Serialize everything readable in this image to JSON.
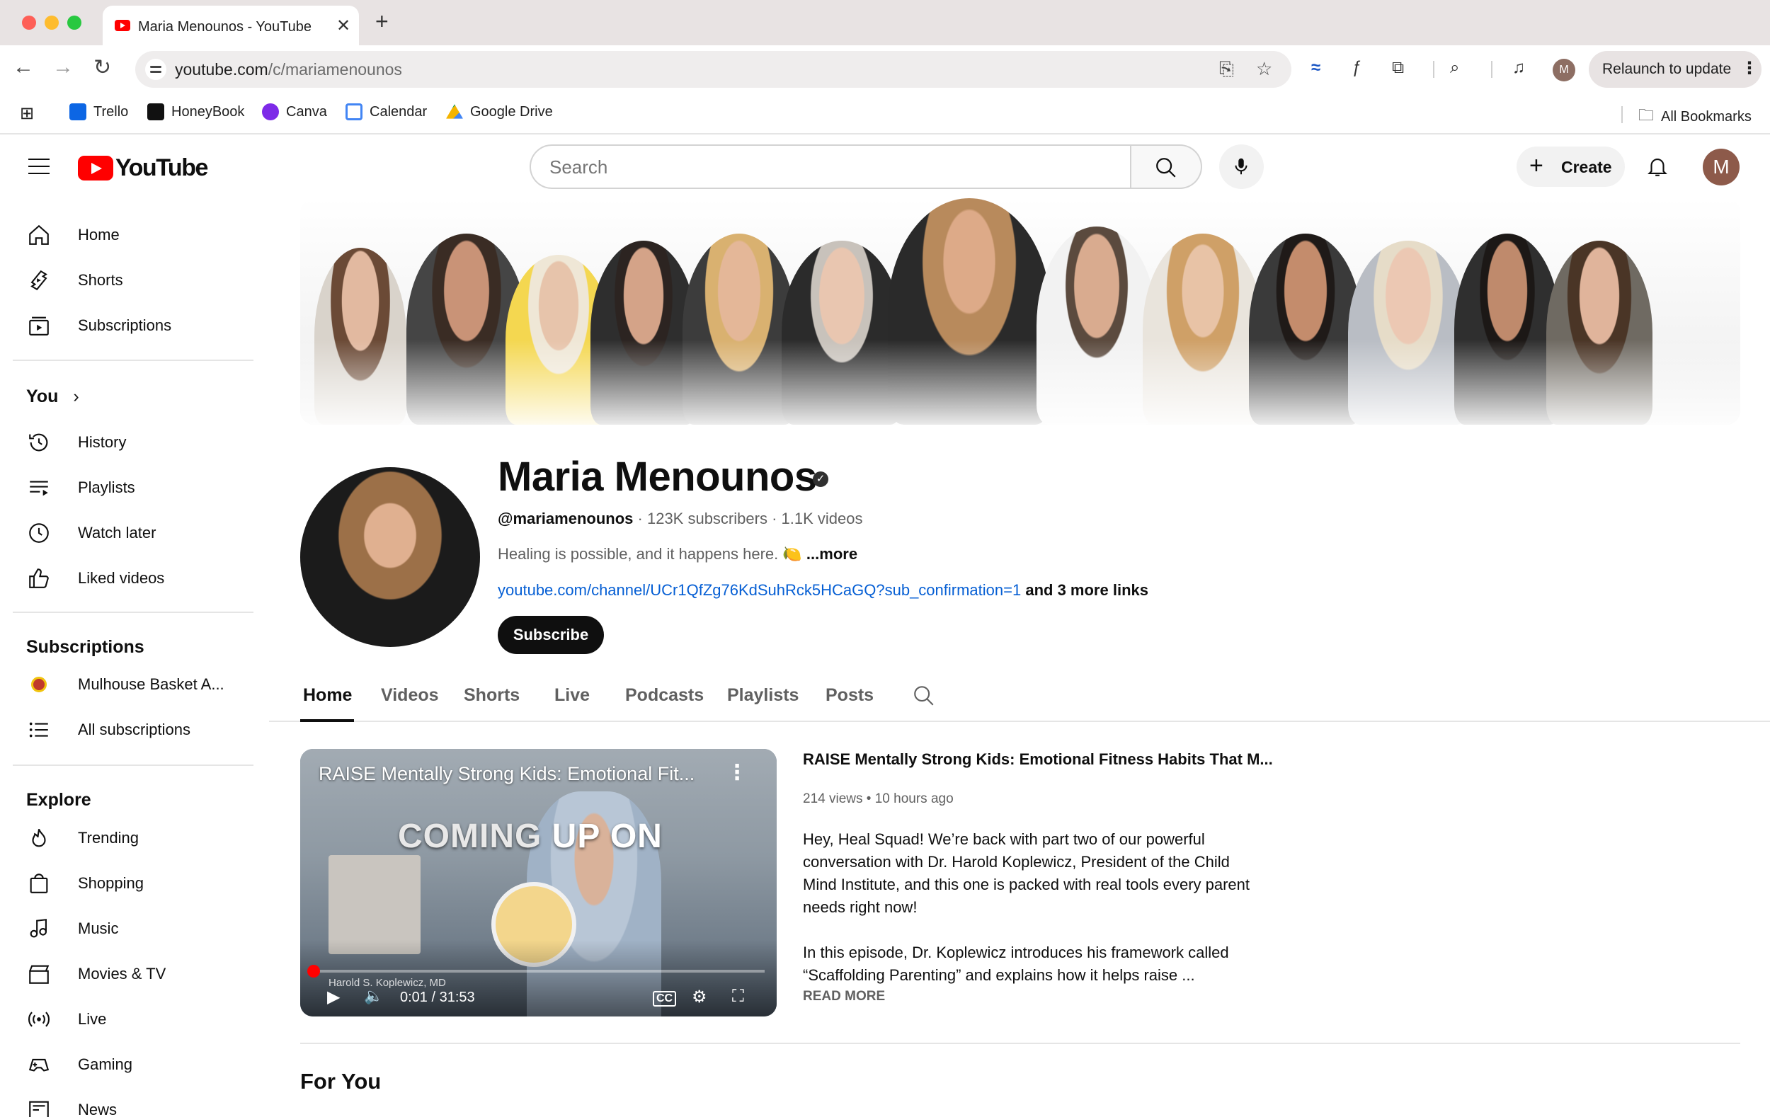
{
  "browser": {
    "tab_title": "Maria Menounos - YouTube",
    "url_host": "youtube.com",
    "url_path": "/c/mariamenounos",
    "profile_initial": "M",
    "relaunch_label": "Relaunch to update",
    "bookmarks": [
      "Trello",
      "HoneyBook",
      "Canva",
      "Calendar",
      "Google Drive"
    ],
    "all_bookmarks": "All Bookmarks"
  },
  "header": {
    "logo_text": "YouTube",
    "search_placeholder": "Search",
    "create_label": "Create",
    "avatar_initial": "M"
  },
  "sidebar": {
    "main": [
      {
        "label": "Home",
        "icon": "home-icon"
      },
      {
        "label": "Shorts",
        "icon": "shorts-icon"
      },
      {
        "label": "Subscriptions",
        "icon": "subscriptions-icon"
      }
    ],
    "you_heading": "You",
    "you_items": [
      {
        "label": "History",
        "icon": "history-icon"
      },
      {
        "label": "Playlists",
        "icon": "playlists-icon"
      },
      {
        "label": "Watch later",
        "icon": "watch-later-icon"
      },
      {
        "label": "Liked videos",
        "icon": "thumbs-up-icon"
      }
    ],
    "subs_heading": "Subscriptions",
    "subs_items": [
      {
        "label": "Mulhouse Basket A...",
        "icon": "channel-avatar"
      },
      {
        "label": "All subscriptions",
        "icon": "list-icon"
      }
    ],
    "explore_heading": "Explore",
    "explore_items": [
      {
        "label": "Trending",
        "icon": "trending-icon"
      },
      {
        "label": "Shopping",
        "icon": "shopping-bag-icon"
      },
      {
        "label": "Music",
        "icon": "music-note-icon"
      },
      {
        "label": "Movies & TV",
        "icon": "clapperboard-icon"
      },
      {
        "label": "Live",
        "icon": "live-icon"
      },
      {
        "label": "Gaming",
        "icon": "gamepad-icon"
      },
      {
        "label": "News",
        "icon": "newspaper-icon"
      }
    ]
  },
  "channel": {
    "name": "Maria Menounos",
    "handle": "@mariamenounos",
    "subscribers": "123K subscribers",
    "videos": "1.1K videos",
    "description": "Healing is possible, and it happens here.",
    "desc_more": "...more",
    "link": "youtube.com/channel/UCr1QfZg76KdSuhRck5HCaGQ?sub_confirmation=1",
    "more_links": "and 3 more links",
    "subscribe_label": "Subscribe",
    "tabs": [
      "Home",
      "Videos",
      "Shorts",
      "Live",
      "Podcasts",
      "Playlists",
      "Posts"
    ],
    "active_tab": "Home"
  },
  "featured_video": {
    "player_title": "RAISE Mentally Strong Kids: Emotional Fit...",
    "overlay_text_1": "COMING",
    "overlay_text_2": "UP ON",
    "lower_third": "Harold S. Koplewicz, MD",
    "time": "0:01 / 31:53",
    "progress_fraction": 0.0005,
    "title": "RAISE Mentally Strong Kids: Emotional Fitness Habits That M...",
    "views": "214 views",
    "age": "10 hours ago",
    "desc_p1": "Hey, Heal Squad! We’re back with part two of our powerful conversation with Dr. Harold Koplewicz, President of the Child Mind Institute, and this one is packed with real tools every parent needs right now!",
    "desc_p2": "In this episode, Dr. Koplewicz introduces his framework called “Scaffolding Parenting” and explains how it helps raise ...",
    "read_more": "READ MORE"
  },
  "sections": {
    "for_you": "For You"
  },
  "colors": {
    "yt_red": "#ff0000",
    "link_blue": "#065fd4",
    "text_primary": "#0f0f0f",
    "text_secondary": "#606060"
  }
}
